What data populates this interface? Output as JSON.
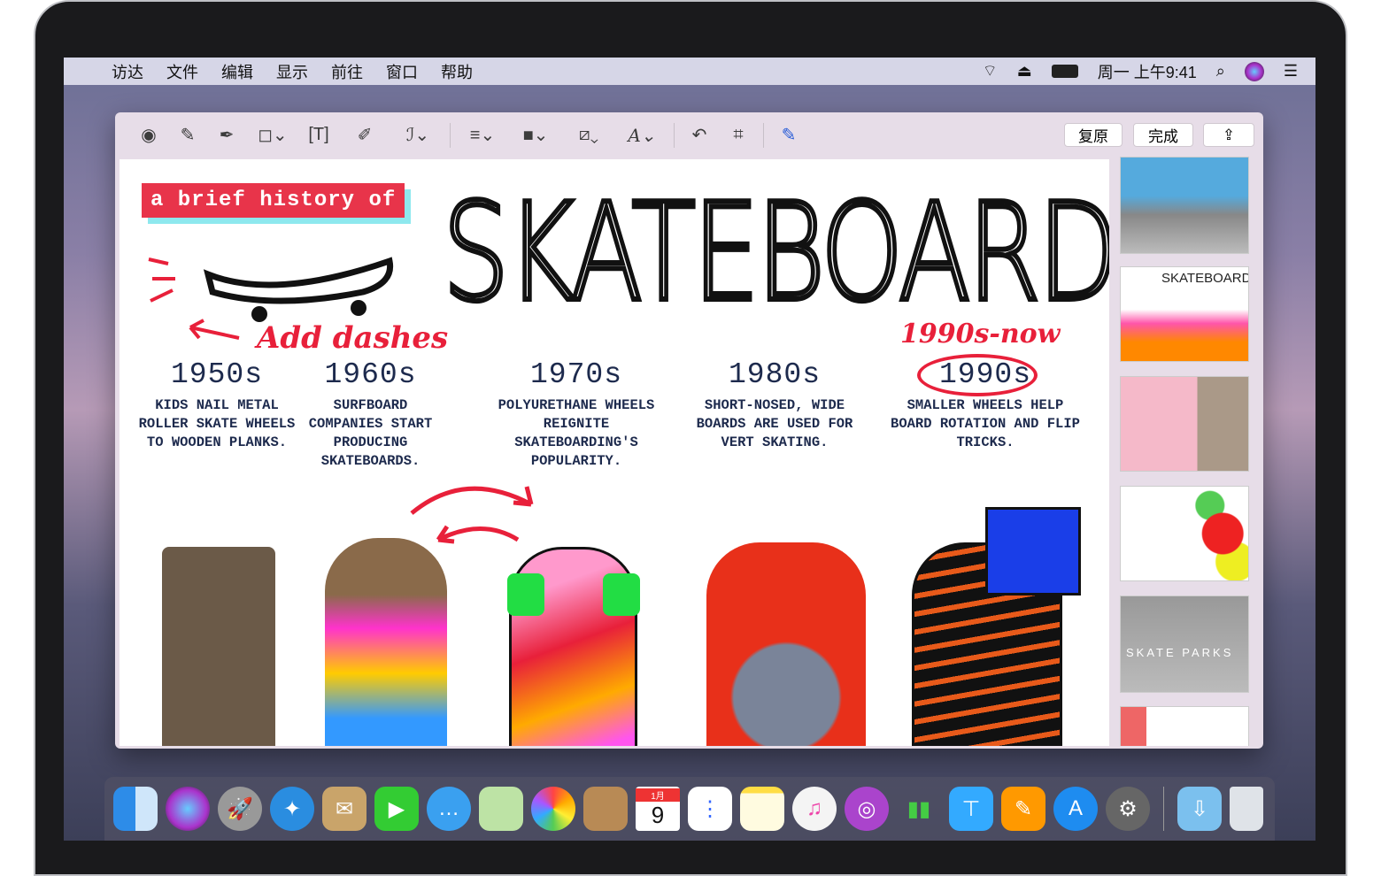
{
  "menubar": {
    "items": [
      "访达",
      "文件",
      "编辑",
      "显示",
      "前往",
      "窗口",
      "帮助"
    ],
    "clock": "周一 上午9:41"
  },
  "toolbar": {
    "revert": "复原",
    "done": "完成"
  },
  "document": {
    "tag": "a brief history of",
    "title": "SKATEBOARDS",
    "annotation_left": "Add dashes",
    "annotation_right": "1990s-now",
    "columns": [
      {
        "decade": "1950s",
        "text": "KIDS NAIL METAL ROLLER SKATE WHEELS TO WOODEN PLANKS."
      },
      {
        "decade": "1960s",
        "text": "SURFBOARD COMPANIES START PRODUCING SKATEBOARDS."
      },
      {
        "decade": "1970s",
        "text": "POLYURETHANE WHEELS REIGNITE SKATEBOARDING'S POPULARITY."
      },
      {
        "decade": "1980s",
        "text": "SHORT-NOSED, WIDE BOARDS ARE USED FOR VERT SKATING."
      },
      {
        "decade": "1990s",
        "text": "SMALLER WHEELS HELP BOARD ROTATION AND FLIP TRICKS."
      }
    ]
  },
  "sidebar": {
    "thumb2_title": "SKATEBOARDS",
    "thumb5_title": "SKATE PARKS"
  },
  "dock": {
    "calendar_month": "1月",
    "calendar_day": "9"
  }
}
